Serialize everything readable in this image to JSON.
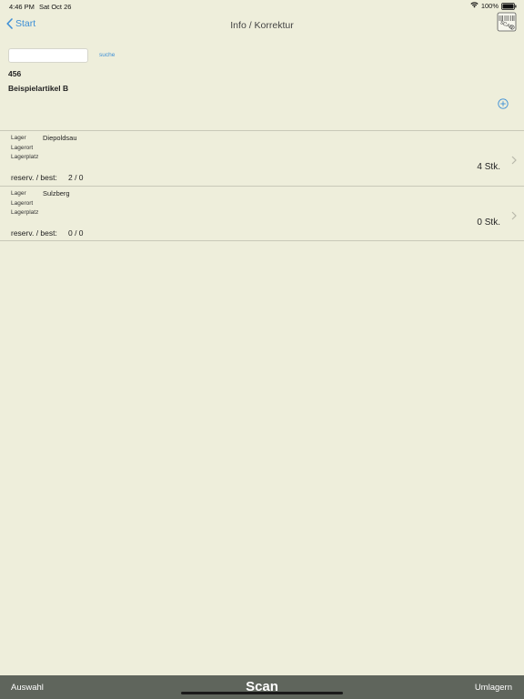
{
  "status_bar": {
    "time": "4:46 PM",
    "date": "Sat Oct 26",
    "battery": "100%",
    "icons": [
      "wifi-icon",
      "battery-icon"
    ]
  },
  "nav": {
    "back_label": "Start",
    "title": "Info / Korrektur",
    "scan_icon_text": "SCAN"
  },
  "search": {
    "value": "",
    "placeholder": "",
    "button_label": "suche"
  },
  "article": {
    "number": "456",
    "name": "Beispielartikel B"
  },
  "stock_rows": [
    {
      "lager_label": "Lager",
      "lager_value": "Diepoldsau",
      "lagerort_label": "Lagerort",
      "lagerplatz_label": "Lagerplatz",
      "reserv_label": "reserv. / best:",
      "reserv_value": "2 / 0",
      "quantity": "4 Stk."
    },
    {
      "lager_label": "Lager",
      "lager_value": "Sulzberg",
      "lagerort_label": "Lagerort",
      "lagerplatz_label": "Lagerplatz",
      "reserv_label": "reserv. / best:",
      "reserv_value": "0 / 0",
      "quantity": "0 Stk."
    }
  ],
  "toolbar": {
    "left_label": "Auswahl",
    "center_label": "Scan",
    "right_label": "Umlagern"
  },
  "colors": {
    "background": "#eeeedb",
    "accent": "#3d8fd6",
    "toolbar": "#5f655c"
  }
}
